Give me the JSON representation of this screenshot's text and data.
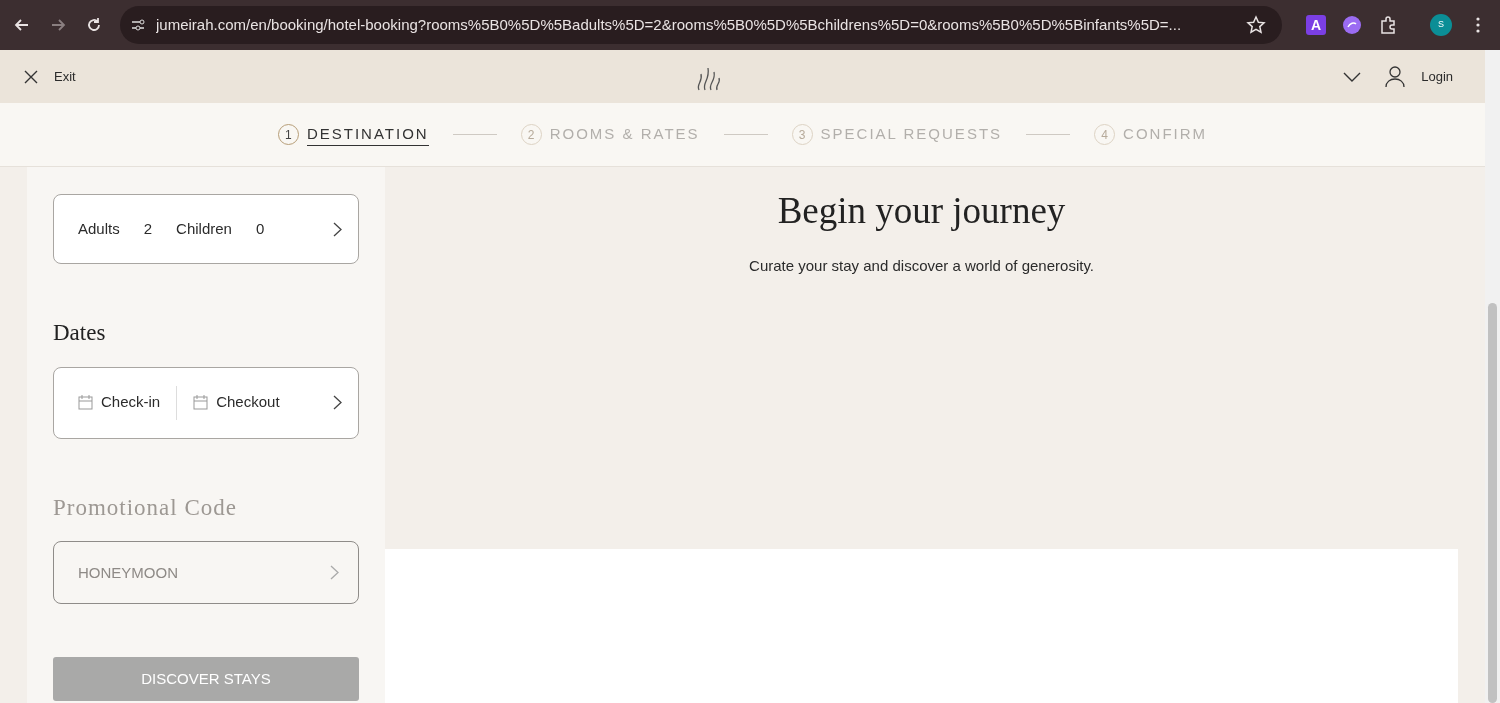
{
  "browser": {
    "url": "jumeirah.com/en/booking/hotel-booking?rooms%5B0%5D%5Badults%5D=2&rooms%5B0%5D%5Bchildrens%5D=0&rooms%5B0%5D%5Binfants%5D=...",
    "profile_initial": "S",
    "extension_letter": "A"
  },
  "header": {
    "exit_label": "Exit",
    "login_label": "Login"
  },
  "steps": [
    {
      "number": "1",
      "label": "DESTINATION",
      "selected": true
    },
    {
      "number": "2",
      "label": "ROOMS & RATES",
      "selected": false
    },
    {
      "number": "3",
      "label": "SPECIAL REQUESTS",
      "selected": false
    },
    {
      "number": "4",
      "label": "CONFIRM",
      "selected": false
    }
  ],
  "guests": [
    {
      "label": "Adults",
      "count": "2"
    },
    {
      "label": "Children",
      "count": "0"
    }
  ],
  "dates": {
    "title": "Dates",
    "checkin": "Check-in",
    "checkout": "Checkout"
  },
  "promo": {
    "title": "Promotional Code",
    "value": "HONEYMOON",
    "disabled": true
  },
  "submit": {
    "label": "DISCOVER STAYS",
    "disabled": true
  },
  "hero": {
    "title": "Begin your journey",
    "subtitle": "Curate your stay and discover a world of generosity."
  }
}
